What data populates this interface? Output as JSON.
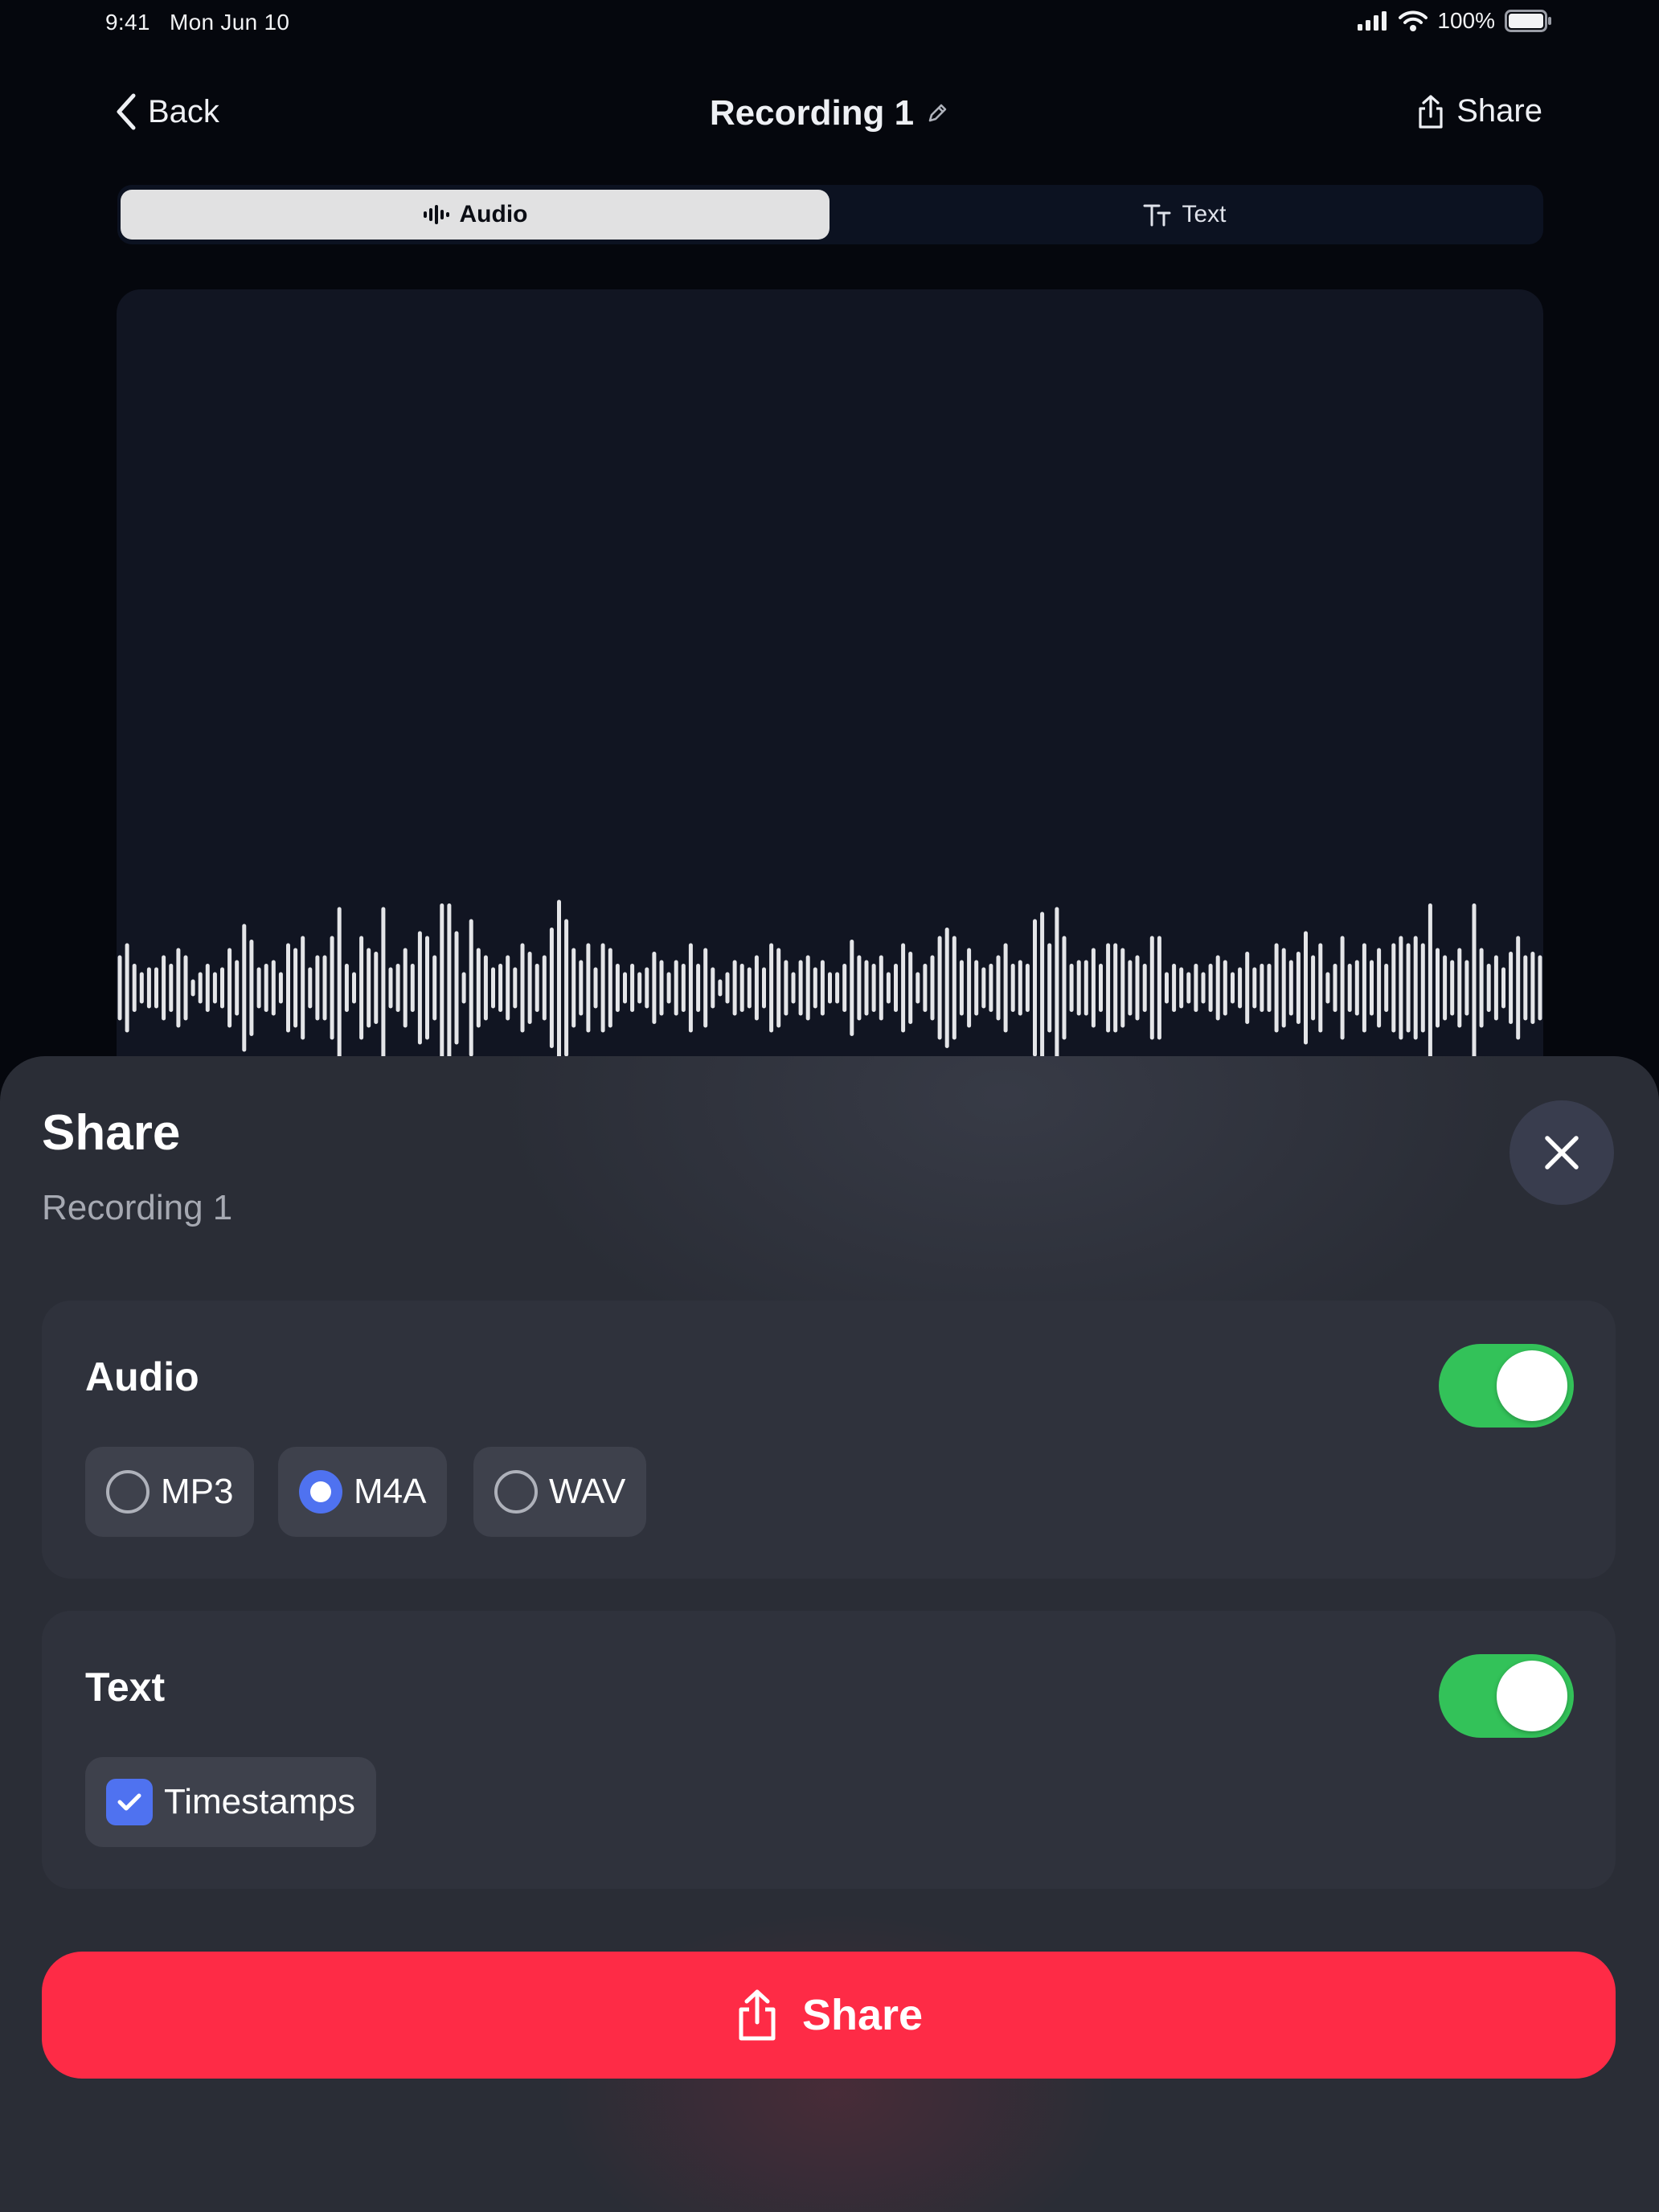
{
  "status_bar": {
    "time": "9:41",
    "date": "Mon Jun 10",
    "battery": "100%"
  },
  "nav": {
    "back_label": "Back",
    "title": "Recording 1",
    "share_label": "Share"
  },
  "tabs": [
    {
      "label": "Audio",
      "icon": "waveform-icon",
      "selected": true
    },
    {
      "label": "Text",
      "icon": "text-size-icon",
      "selected": false
    }
  ],
  "waveform": {
    "levels": [
      0.27,
      0.37,
      0.2,
      0.13,
      0.17,
      0.17,
      0.27,
      0.2,
      0.33,
      0.27,
      0.07,
      0.13,
      0.2,
      0.13,
      0.17,
      0.33,
      0.23,
      0.53,
      0.4,
      0.17,
      0.2,
      0.23,
      0.13,
      0.37,
      0.33,
      0.43,
      0.17,
      0.27,
      0.27,
      0.43,
      0.67,
      0.2,
      0.13,
      0.43,
      0.33,
      0.3,
      0.67,
      0.17,
      0.2,
      0.33,
      0.2,
      0.47,
      0.43,
      0.27,
      0.7,
      0.7,
      0.47,
      0.13,
      0.57,
      0.33,
      0.27,
      0.17,
      0.2,
      0.27,
      0.17,
      0.37,
      0.3,
      0.2,
      0.27,
      0.5,
      0.73,
      0.57,
      0.33,
      0.23,
      0.37,
      0.17,
      0.37,
      0.33,
      0.2,
      0.13,
      0.2,
      0.13,
      0.17,
      0.3,
      0.23,
      0.13,
      0.23,
      0.2,
      0.37,
      0.2,
      0.33,
      0.17,
      0.07,
      0.13,
      0.23,
      0.2,
      0.17,
      0.27,
      0.17,
      0.37,
      0.33,
      0.23,
      0.13,
      0.23,
      0.27,
      0.17,
      0.23,
      0.13,
      0.13,
      0.2,
      0.4,
      0.27,
      0.23,
      0.2,
      0.27,
      0.13,
      0.2,
      0.37,
      0.3,
      0.13,
      0.2,
      0.27,
      0.43,
      0.5,
      0.43,
      0.23,
      0.33,
      0.23,
      0.17,
      0.2,
      0.27,
      0.37,
      0.2,
      0.23,
      0.2,
      0.57,
      0.63,
      0.37,
      0.67,
      0.43,
      0.2,
      0.23,
      0.23,
      0.33,
      0.2,
      0.37,
      0.37,
      0.33,
      0.23,
      0.27,
      0.2,
      0.43,
      0.43,
      0.13,
      0.2,
      0.17,
      0.13,
      0.2,
      0.13,
      0.2,
      0.27,
      0.23,
      0.13,
      0.17,
      0.3,
      0.17,
      0.2,
      0.2,
      0.37,
      0.33,
      0.23,
      0.3,
      0.47,
      0.27,
      0.37,
      0.13,
      0.2,
      0.43,
      0.2,
      0.23,
      0.37,
      0.23,
      0.33,
      0.2,
      0.37,
      0.43,
      0.37,
      0.43,
      0.37,
      0.7,
      0.33,
      0.27,
      0.23,
      0.33,
      0.23,
      0.7,
      0.33,
      0.2,
      0.27,
      0.17,
      0.3,
      0.43,
      0.27,
      0.3,
      0.27
    ]
  },
  "sheet": {
    "title": "Share",
    "subtitle": "Recording 1",
    "audio": {
      "label": "Audio",
      "enabled": true,
      "formats": [
        {
          "label": "MP3",
          "selected": false
        },
        {
          "label": "M4A",
          "selected": true
        },
        {
          "label": "WAV",
          "selected": false
        }
      ]
    },
    "text": {
      "label": "Text",
      "enabled": true,
      "options": [
        {
          "label": "Timestamps",
          "checked": true
        }
      ]
    },
    "share_button": "Share"
  },
  "colors": {
    "accent_blue": "#4f72f0",
    "toggle_green": "#33c259",
    "share_red": "#fe2b46",
    "background": "#05070d"
  }
}
